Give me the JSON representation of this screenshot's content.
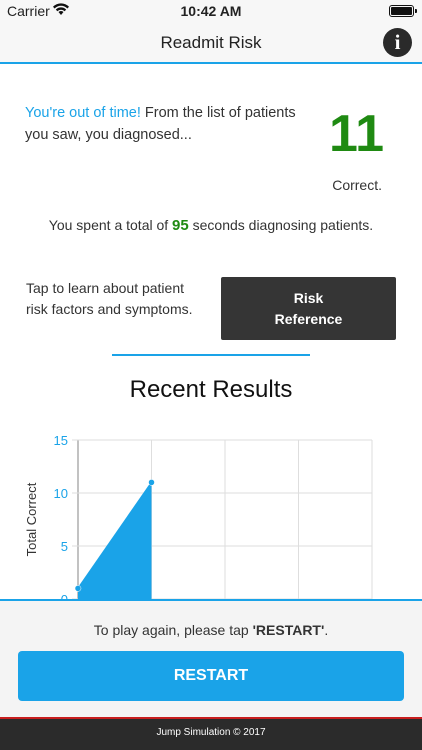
{
  "status_bar": {
    "carrier": "Carrier",
    "wifi_icon": "wifi-icon",
    "time": "10:42 AM",
    "battery_icon": "battery-icon"
  },
  "nav": {
    "title": "Readmit Risk",
    "info_icon": "i"
  },
  "summary": {
    "out_of_time": "You're out of time!",
    "diagnosed_text": " From the list of patients you saw, you diagnosed...",
    "score": "11",
    "correct_label": "Correct.",
    "time_prefix": "You spent a total of ",
    "seconds": "95",
    "time_suffix": " seconds diagnosing patients."
  },
  "risk": {
    "description": "Tap to learn about patient risk factors and symptoms.",
    "button_line1": "Risk",
    "button_line2": "Reference"
  },
  "results": {
    "title": "Recent Results"
  },
  "chart_data": {
    "type": "area",
    "ylabel": "Total Correct",
    "ylim": [
      0,
      15
    ],
    "yticks": [
      "15",
      "10",
      "5",
      "0"
    ],
    "x": [
      1,
      2
    ],
    "values": [
      1,
      11
    ],
    "color": "#1aa3e8"
  },
  "bottom": {
    "play_again_prefix": "To play again, please tap ",
    "play_again_keyword": "'RESTART'",
    "play_again_suffix": ".",
    "restart_label": "RESTART"
  },
  "footer": {
    "copyright": "Jump Simulation © 2017"
  }
}
